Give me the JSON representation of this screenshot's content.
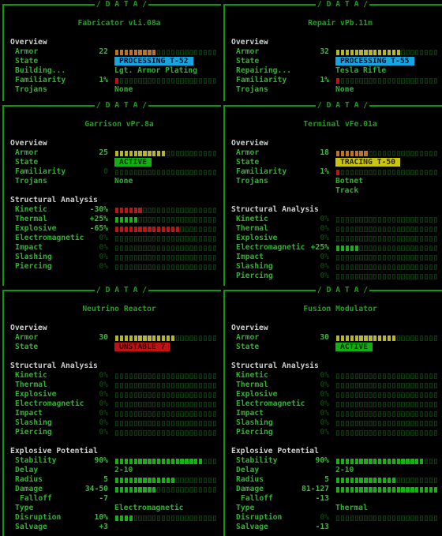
{
  "header_label": "/ D A T A /",
  "bar_segments": 22,
  "palette": {
    "orange": "#c4721c",
    "yellow": "#b8b81e",
    "red": "#c41212",
    "green": "#12b412"
  },
  "badge_styles": {
    "blue": {
      "bg": "#15a5e1",
      "fg": "#04142c"
    },
    "green": {
      "bg": "#12b012",
      "fg": "#022a02"
    },
    "yellow": {
      "bg": "#c9c512",
      "fg": "#2a2800"
    },
    "red": {
      "bg": "#c01414",
      "fg": "#2a0000"
    }
  },
  "panels": [
    {
      "title": "Fabricator vLi.08a",
      "sections": [
        {
          "heading": "Overview",
          "rows": [
            {
              "label": "Armor",
              "value": "22",
              "bar": {
                "filled": 9,
                "color": "orange"
              }
            },
            {
              "label": "State",
              "badge": {
                "text": "PROCESSING T-52",
                "style": "blue"
              }
            },
            {
              "label": "Building...",
              "text": "Lgt. Armor Plating"
            },
            {
              "label": "Familiarity",
              "value": "1%",
              "bar": {
                "filled": 1,
                "color": "red"
              }
            },
            {
              "label": "Trojans",
              "text": "None"
            }
          ]
        }
      ]
    },
    {
      "title": "Repair vPb.11m",
      "sections": [
        {
          "heading": "Overview",
          "rows": [
            {
              "label": "Armor",
              "value": "32",
              "bar": {
                "filled": 14,
                "color": "yellow"
              }
            },
            {
              "label": "State",
              "badge": {
                "text": "PROCESSING T-55",
                "style": "blue"
              }
            },
            {
              "label": "Repairing...",
              "text": "Tesla Rifle"
            },
            {
              "label": "Familiarity",
              "value": "1%",
              "bar": {
                "filled": 1,
                "color": "red"
              }
            },
            {
              "label": "Trojans",
              "text": "None"
            }
          ]
        }
      ]
    },
    {
      "title": "Garrison vPr.8a",
      "sections": [
        {
          "heading": "Overview",
          "rows": [
            {
              "label": "Armor",
              "value": "25",
              "bar": {
                "filled": 11,
                "color": "yellow"
              }
            },
            {
              "label": "State",
              "badge": {
                "text": "ACTIVE",
                "style": "green"
              }
            },
            {
              "label": "Familiarity",
              "value": "0",
              "dim": true,
              "bar": {
                "filled": 0,
                "color": "red"
              }
            },
            {
              "label": "Trojans",
              "text": "None"
            }
          ]
        },
        {
          "heading": "Structural Analysis",
          "rows": [
            {
              "label": "Kinetic",
              "value": "-30%",
              "bar": {
                "filled": 6,
                "color": "red"
              }
            },
            {
              "label": "Thermal",
              "value": "+25%",
              "bar": {
                "filled": 5,
                "color": "green"
              }
            },
            {
              "label": "Explosive",
              "value": "-65%",
              "bar": {
                "filled": 14,
                "color": "red"
              }
            },
            {
              "label": "Electromagnetic",
              "value": "0%",
              "dim": true,
              "bar": {
                "filled": 0,
                "color": "green"
              }
            },
            {
              "label": "Impact",
              "value": "0%",
              "dim": true,
              "bar": {
                "filled": 0,
                "color": "green"
              }
            },
            {
              "label": "Slashing",
              "value": "0%",
              "dim": true,
              "bar": {
                "filled": 0,
                "color": "green"
              }
            },
            {
              "label": "Piercing",
              "value": "0%",
              "dim": true,
              "bar": {
                "filled": 0,
                "color": "green"
              }
            }
          ]
        }
      ]
    },
    {
      "title": "Terminal vFe.01a",
      "sections": [
        {
          "heading": "Overview",
          "rows": [
            {
              "label": "Armor",
              "value": "18",
              "bar": {
                "filled": 7,
                "color": "orange"
              }
            },
            {
              "label": "State",
              "badge": {
                "text": "TRACING T-50",
                "style": "yellow"
              }
            },
            {
              "label": "Familiarity",
              "value": "1%",
              "bar": {
                "filled": 1,
                "color": "red"
              }
            },
            {
              "label": "Trojans",
              "text": "Botnet"
            },
            {
              "text": "Track"
            }
          ]
        },
        {
          "heading": "Structural Analysis",
          "rows": [
            {
              "label": "Kinetic",
              "value": "0%",
              "dim": true,
              "bar": {
                "filled": 0,
                "color": "green"
              }
            },
            {
              "label": "Thermal",
              "value": "0%",
              "dim": true,
              "bar": {
                "filled": 0,
                "color": "green"
              }
            },
            {
              "label": "Explosive",
              "value": "0%",
              "dim": true,
              "bar": {
                "filled": 0,
                "color": "green"
              }
            },
            {
              "label": "Electromagnetic",
              "value": "+25%",
              "bar": {
                "filled": 5,
                "color": "green"
              }
            },
            {
              "label": "Impact",
              "value": "0%",
              "dim": true,
              "bar": {
                "filled": 0,
                "color": "green"
              }
            },
            {
              "label": "Slashing",
              "value": "0%",
              "dim": true,
              "bar": {
                "filled": 0,
                "color": "green"
              }
            },
            {
              "label": "Piercing",
              "value": "0%",
              "dim": true,
              "bar": {
                "filled": 0,
                "color": "green"
              }
            }
          ]
        }
      ]
    },
    {
      "title": "Neutrino Reactor",
      "sections": [
        {
          "heading": "Overview",
          "rows": [
            {
              "label": "Armor",
              "value": "30",
              "bar": {
                "filled": 13,
                "color": "yellow"
              }
            },
            {
              "label": "State",
              "badge": {
                "text": "UNSTABLE 7",
                "style": "red"
              }
            }
          ]
        },
        {
          "heading": "Structural Analysis",
          "rows": [
            {
              "label": "Kinetic",
              "value": "0%",
              "dim": true,
              "bar": {
                "filled": 0,
                "color": "green"
              }
            },
            {
              "label": "Thermal",
              "value": "0%",
              "dim": true,
              "bar": {
                "filled": 0,
                "color": "green"
              }
            },
            {
              "label": "Explosive",
              "value": "0%",
              "dim": true,
              "bar": {
                "filled": 0,
                "color": "green"
              }
            },
            {
              "label": "Electromagnetic",
              "value": "0%",
              "dim": true,
              "bar": {
                "filled": 0,
                "color": "green"
              }
            },
            {
              "label": "Impact",
              "value": "0%",
              "dim": true,
              "bar": {
                "filled": 0,
                "color": "green"
              }
            },
            {
              "label": "Slashing",
              "value": "0%",
              "dim": true,
              "bar": {
                "filled": 0,
                "color": "green"
              }
            },
            {
              "label": "Piercing",
              "value": "0%",
              "dim": true,
              "bar": {
                "filled": 0,
                "color": "green"
              }
            }
          ]
        },
        {
          "heading": "Explosive Potential",
          "rows": [
            {
              "label": "Stability",
              "value": "90%",
              "bar": {
                "filled": 19,
                "color": "green"
              }
            },
            {
              "label": "Delay",
              "text": "2-10"
            },
            {
              "label": "Radius",
              "value": "5",
              "bar": {
                "filled": 13,
                "color": "green"
              }
            },
            {
              "label": "Damage",
              "value": "34-50",
              "bar": {
                "filled": 9,
                "color": "green"
              }
            },
            {
              "label": "Falloff",
              "sub": true,
              "value": "-7"
            },
            {
              "label": "Type",
              "text": "Electromagnetic"
            },
            {
              "label": "Disruption",
              "value": "10%",
              "bar": {
                "filled": 4,
                "color": "green"
              }
            },
            {
              "label": "Salvage",
              "value": "+3"
            }
          ]
        }
      ]
    },
    {
      "title": "Fusion Modulator",
      "sections": [
        {
          "heading": "Overview",
          "rows": [
            {
              "label": "Armor",
              "value": "30",
              "bar": {
                "filled": 13,
                "color": "yellow"
              }
            },
            {
              "label": "State",
              "badge": {
                "text": "ACTIVE",
                "style": "green"
              }
            }
          ]
        },
        {
          "heading": "Structural Analysis",
          "rows": [
            {
              "label": "Kinetic",
              "value": "0%",
              "dim": true,
              "bar": {
                "filled": 0,
                "color": "green"
              }
            },
            {
              "label": "Thermal",
              "value": "0%",
              "dim": true,
              "bar": {
                "filled": 0,
                "color": "green"
              }
            },
            {
              "label": "Explosive",
              "value": "0%",
              "dim": true,
              "bar": {
                "filled": 0,
                "color": "green"
              }
            },
            {
              "label": "Electromagnetic",
              "value": "0%",
              "dim": true,
              "bar": {
                "filled": 0,
                "color": "green"
              }
            },
            {
              "label": "Impact",
              "value": "0%",
              "dim": true,
              "bar": {
                "filled": 0,
                "color": "green"
              }
            },
            {
              "label": "Slashing",
              "value": "0%",
              "dim": true,
              "bar": {
                "filled": 0,
                "color": "green"
              }
            },
            {
              "label": "Piercing",
              "value": "0%",
              "dim": true,
              "bar": {
                "filled": 0,
                "color": "green"
              }
            }
          ]
        },
        {
          "heading": "Explosive Potential",
          "rows": [
            {
              "label": "Stability",
              "value": "90%",
              "bar": {
                "filled": 19,
                "color": "green"
              }
            },
            {
              "label": "Delay",
              "text": "2-10"
            },
            {
              "label": "Radius",
              "value": "5",
              "bar": {
                "filled": 13,
                "color": "green"
              }
            },
            {
              "label": "Damage",
              "value": "81-127",
              "bar": {
                "filled": 22,
                "color": "green"
              }
            },
            {
              "label": "Falloff",
              "sub": true,
              "value": "-13"
            },
            {
              "label": "Type",
              "text": "Thermal"
            },
            {
              "label": "Disruption",
              "value": "0%",
              "dim": true,
              "bar": {
                "filled": 0,
                "color": "green"
              }
            },
            {
              "label": "Salvage",
              "value": "-13"
            }
          ]
        }
      ]
    }
  ]
}
